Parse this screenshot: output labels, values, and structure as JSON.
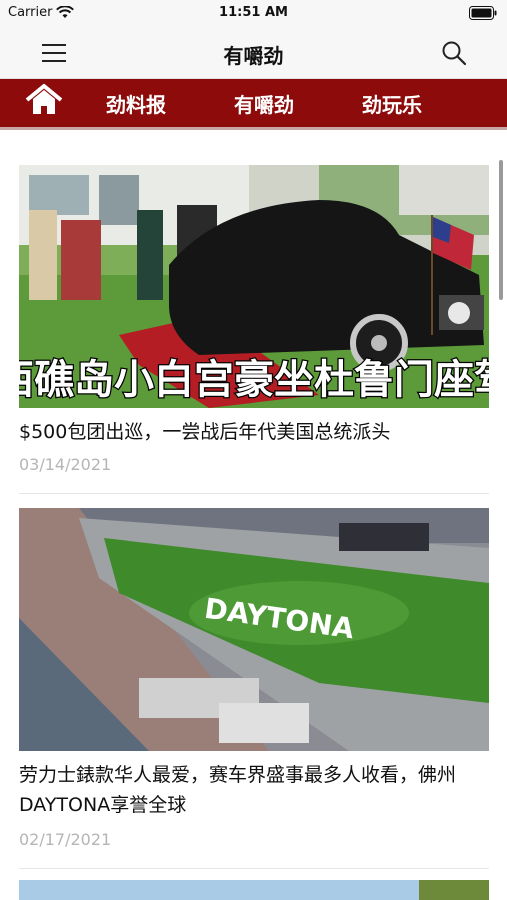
{
  "status_bar": {
    "carrier": "Carrier",
    "time": "11:51 AM"
  },
  "nav": {
    "title": "有嚼劲",
    "menu_icon": "hamburger-menu-icon",
    "search_icon": "search-icon"
  },
  "categories": {
    "home_icon": "home-icon",
    "tabs": [
      {
        "label": "劲料报"
      },
      {
        "label": "有嚼劲"
      },
      {
        "label": "劲玩乐"
      }
    ],
    "bar_color": "#8e0b0b"
  },
  "articles": [
    {
      "image_caption": "西礁岛小白宫豪坐杜鲁门座驾",
      "headline": "$500包团出巡，一尝战后年代美国总统派头",
      "date": "03/14/2021"
    },
    {
      "image_text": "DAYTONA",
      "headline": "劳力士錶款华人最爱，赛车界盛事最多人收看，佛州DAYTONA享誉全球",
      "date": "02/17/2021"
    }
  ]
}
